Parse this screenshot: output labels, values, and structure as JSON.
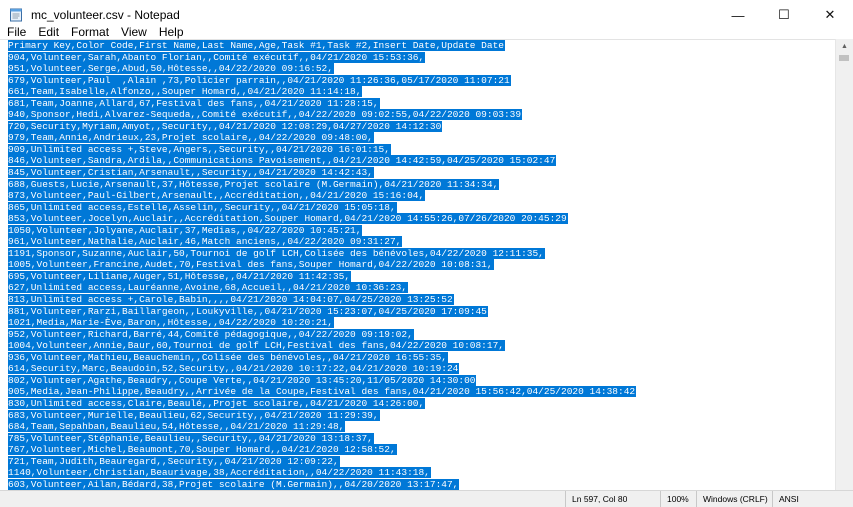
{
  "window": {
    "title": "mc_volunteer.csv - Notepad",
    "minimize": "—",
    "maximize": "☐",
    "close": "✕",
    "app_icon": "notepad-icon"
  },
  "menu": [
    "File",
    "Edit",
    "Format",
    "View",
    "Help"
  ],
  "editor": {
    "selection_color": "#0078d7",
    "lines": [
      "Primary Key,Color Code,First Name,Last Name,Age,Task #1,Task #2,Insert Date,Update Date",
      "904,Volunteer,Sarah,Abanto Florian,,Comité exécutif,,04/21/2020 15:53:36,",
      "951,Volunteer,Serge,Abud,50,Hôtesse,,04/22/2020 09:16:52,",
      "679,Volunteer,Paul  ,Alain ,73,Policier parrain,,04/21/2020 11:26:36,05/17/2020 11:07:21",
      "661,Team,Isabelle,Alfonzo,,Souper Homard,,04/21/2020 11:14:18,",
      "681,Team,Joanne,Allard,67,Festival des fans,,04/21/2020 11:28:15,",
      "940,Sponsor,Hedi,Alvarez-Sequeda,,Comité exécutif,,04/22/2020 09:02:55,04/22/2020 09:03:39",
      "720,Security,Myriam,Amyot,,Security,,04/21/2020 12:08:29,04/27/2020 14:12:30",
      "979,Team,Annie,Andrieux,23,Projet scolaire,,04/22/2020 09:48:00,",
      "909,Unlimited access +,Steve,Angers,,Security,,04/21/2020 16:01:15,",
      "846,Volunteer,Sandra,Ardila,,Communications Pavoisement,,04/21/2020 14:42:59,04/25/2020 15:02:47",
      "845,Volunteer,Cristian,Arsenault,,Security,,04/21/2020 14:42:43,",
      "688,Guests,Lucie,Arsenault,37,Hôtesse,Projet scolaire (M.Germain),04/21/2020 11:34:34,",
      "873,Volunteer,Paul-Gilbert,Arsenault,,Accréditation,,04/21/2020 15:16:04,",
      "865,Unlimited access,Estelle,Asselin,,Security,,04/21/2020 15:05:18,",
      "853,Volunteer,Jocelyn,Auclair,,Accréditation,Souper Homard,04/21/2020 14:55:26,07/26/2020 20:45:29",
      "1050,Volunteer,Jolyane,Auclair,37,Medias,,04/22/2020 10:45:21,",
      "961,Volunteer,Nathalie,Auclair,46,Match anciens,,04/22/2020 09:31:27,",
      "1191,Sponsor,Suzanne,Auclair,50,Tournoi de golf LCH,Colisée des bénévoles,04/22/2020 12:11:35,",
      "1005,Volunteer,Francine,Audet,70,Festival des fans,Souper Homard,04/22/2020 10:08:31,",
      "695,Volunteer,Liliane,Auger,51,Hôtesse,,04/21/2020 11:42:35,",
      "627,Unlimited access,Lauréanne,Avoine,68,Accueil,,04/21/2020 10:36:23,",
      "813,Unlimited access +,Carole,Babin,,,,04/21/2020 14:04:07,04/25/2020 13:25:52",
      "881,Volunteer,Rarzi,Baillargeon,,Loukyville,,04/21/2020 15:23:07,04/25/2020 17:09:45",
      "1021,Media,Marie-Ève,Baron,,Hôtesse,,04/22/2020 10:20:21,",
      "952,Volunteer,Richard,Barré,44,Comité pédagogique,,04/22/2020 09:19:02,",
      "1004,Volunteer,Annie,Baur,60,Tournoi de golf LCH,Festival des fans,04/22/2020 10:08:17,",
      "936,Volunteer,Mathieu,Beauchemin,,Colisée des bénévoles,,04/21/2020 16:55:35,",
      "614,Security,Marc,Beaudoin,52,Security,,04/21/2020 10:17:22,04/21/2020 10:19:24",
      "802,Volunteer,Agathe,Beaudry,,Coupe Verte,,04/21/2020 13:45:20,11/05/2020 14:30:00",
      "905,Media,Jean-Philippe,Beaudry,,Arrivée de la Coupe,Festival des fans,04/21/2020 15:56:42,04/25/2020 14:38:42",
      "830,Unlimited access,Claire,Beaulé,,Projet scolaire,,04/21/2020 14:26:00,",
      "683,Volunteer,Murielle,Beaulieu,62,Security,,04/21/2020 11:29:39,",
      "684,Team,Sepahban,Beaulieu,54,Hôtesse,,04/21/2020 11:29:48,",
      "785,Volunteer,Stéphanie,Beaulieu,,Security,,04/21/2020 13:18:37,",
      "767,Volunteer,Michel,Beaumont,70,Souper Homard,,04/21/2020 12:58:52,",
      "721,Team,Judith,Beauregard,,Security,,04/21/2020 12:09:22,",
      "1140,Volunteer,Christian,Beaurivage,38,Accréditation,,04/22/2020 11:43:18,",
      "603,Volunteer,Ailan,Bédard,38,Projet scolaire (M.Germain),,04/20/2020 13:17:47,"
    ]
  },
  "status": {
    "position": "Ln 597, Col 80",
    "zoom": "100%",
    "line_endings": "Windows (CRLF)",
    "encoding": "ANSI"
  }
}
